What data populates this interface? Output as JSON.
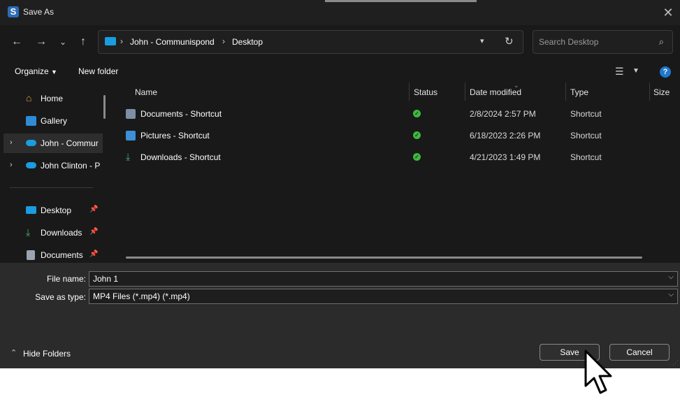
{
  "window": {
    "title": "Save As",
    "close_glyph": "✕"
  },
  "address_bar": {
    "segments": [
      "John - Communispond",
      "Desktop"
    ],
    "separator": "›"
  },
  "search": {
    "placeholder": "Search Desktop"
  },
  "command_bar": {
    "organize": "Organize",
    "new_folder": "New folder"
  },
  "nav": {
    "items": [
      {
        "label": "Home",
        "icon": "home-icon"
      },
      {
        "label": "Gallery",
        "icon": "gallery-icon"
      },
      {
        "label": "John - Commur",
        "icon": "onedrive-icon",
        "expandable": true,
        "selected": true
      },
      {
        "label": "John Clinton - P",
        "icon": "onedrive-icon",
        "expandable": true
      },
      {
        "label": "Desktop",
        "icon": "desktop-icon",
        "pinned": true
      },
      {
        "label": "Downloads",
        "icon": "downloads-icon",
        "pinned": true
      },
      {
        "label": "Documents",
        "icon": "documents-icon",
        "pinned": true
      }
    ]
  },
  "file_list": {
    "columns": [
      "Name",
      "Status",
      "Date modified",
      "Type",
      "Size"
    ],
    "rows": [
      {
        "name": "Documents - Shortcut",
        "status": "synced",
        "date": "2/8/2024 2:57 PM",
        "type": "Shortcut"
      },
      {
        "name": "Pictures - Shortcut",
        "status": "synced",
        "date": "6/18/2023 2:26 PM",
        "type": "Shortcut"
      },
      {
        "name": "Downloads - Shortcut",
        "status": "synced",
        "date": "4/21/2023 1:49 PM",
        "type": "Shortcut"
      }
    ]
  },
  "form": {
    "file_name_label": "File name:",
    "file_name_value": "John 1",
    "save_type_label": "Save as type:",
    "save_type_value": "MP4 Files (*.mp4) (*.mp4)"
  },
  "footer": {
    "hide_folders": "Hide Folders",
    "save": "Save",
    "cancel": "Cancel"
  },
  "colors": {
    "accent": "#1e78d0",
    "onedrive": "#1a9ce0",
    "status_ok": "#3fb83f",
    "bg": "#191919",
    "bottom_bg": "#2b2b2b"
  }
}
